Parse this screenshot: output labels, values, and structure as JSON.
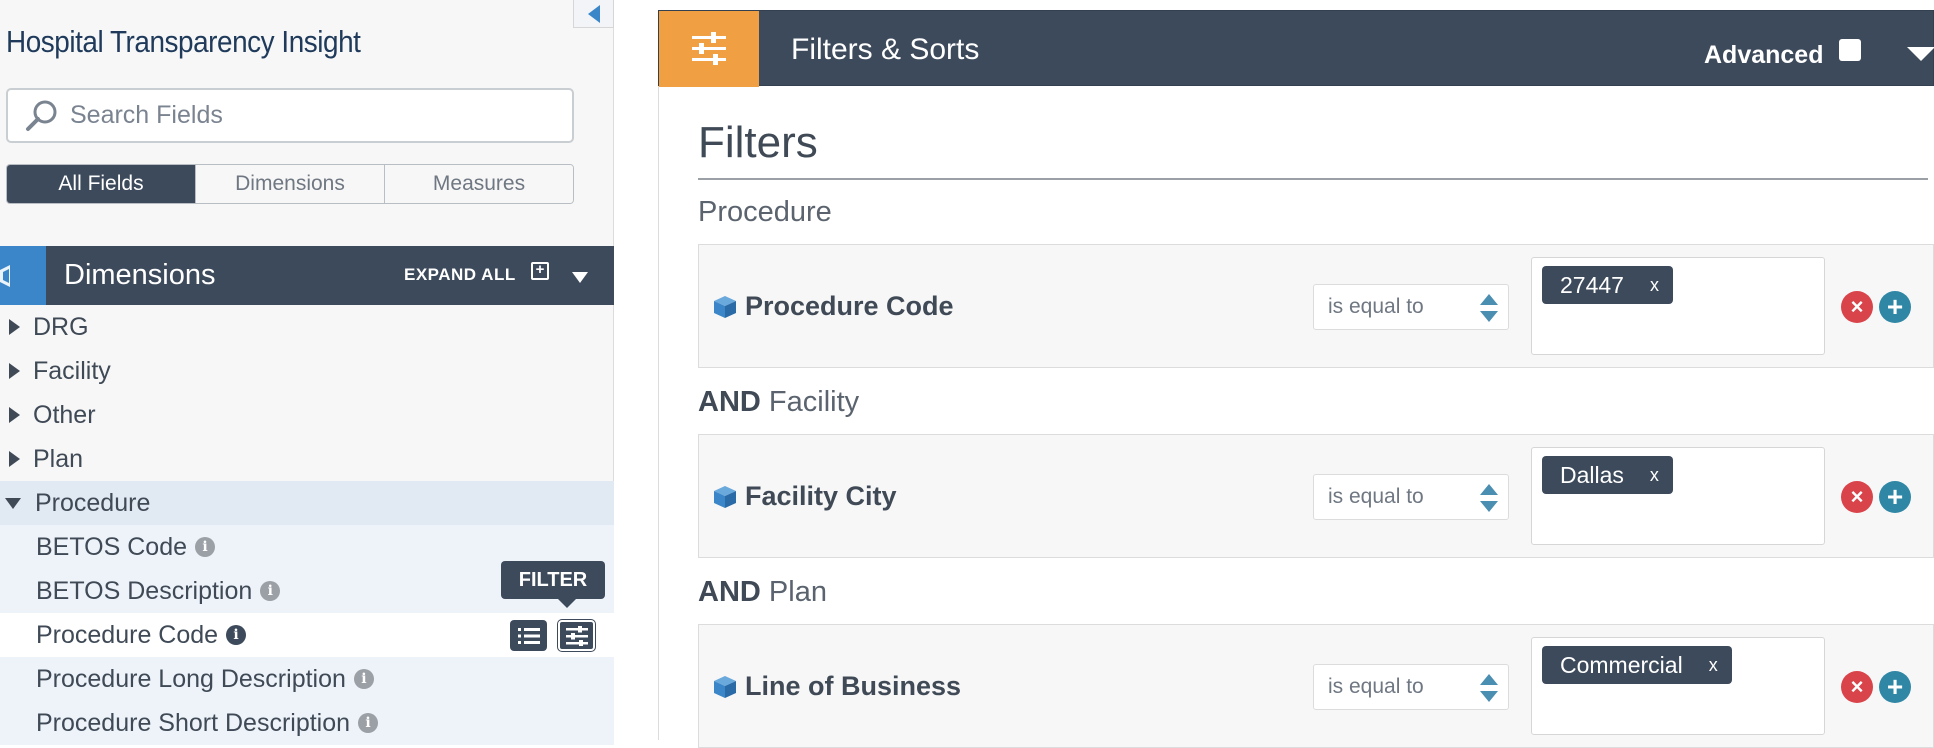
{
  "app": {
    "title": "Hospital Transparency Insight"
  },
  "search": {
    "placeholder": "Search Fields"
  },
  "field_tabs": [
    "All Fields",
    "Dimensions",
    "Measures"
  ],
  "dimensions_panel": {
    "title": "Dimensions",
    "expand_all": "EXPAND ALL",
    "groups": [
      "DRG",
      "Facility",
      "Other",
      "Plan",
      "Procedure"
    ],
    "procedure_fields": [
      "BETOS Code",
      "BETOS Description",
      "Procedure Code",
      "Procedure Long Description",
      "Procedure Short Description"
    ],
    "tooltip": "FILTER"
  },
  "filters_panel": {
    "title": "Filters & Sorts",
    "advanced_label": "Advanced",
    "heading": "Filters",
    "filters": [
      {
        "connector": "",
        "group": "Procedure",
        "field": "Procedure Code",
        "operator": "is equal to",
        "value": "27447"
      },
      {
        "connector": "AND",
        "group": "Facility",
        "field": "Facility City",
        "operator": "is equal to",
        "value": "Dallas"
      },
      {
        "connector": "AND",
        "group": "Plan",
        "field": "Line of Business",
        "operator": "is equal to",
        "value": "Commercial"
      }
    ]
  },
  "colors": {
    "dark": "#3d4a5b",
    "accent_blue": "#3a86c8",
    "orange": "#f0a043",
    "remove_red": "#d9434a",
    "add_teal": "#2f87a5"
  },
  "icons": {
    "search": "search-icon",
    "cube": "cube-icon",
    "filter_sort": "sliders-icon",
    "list": "list-icon"
  }
}
